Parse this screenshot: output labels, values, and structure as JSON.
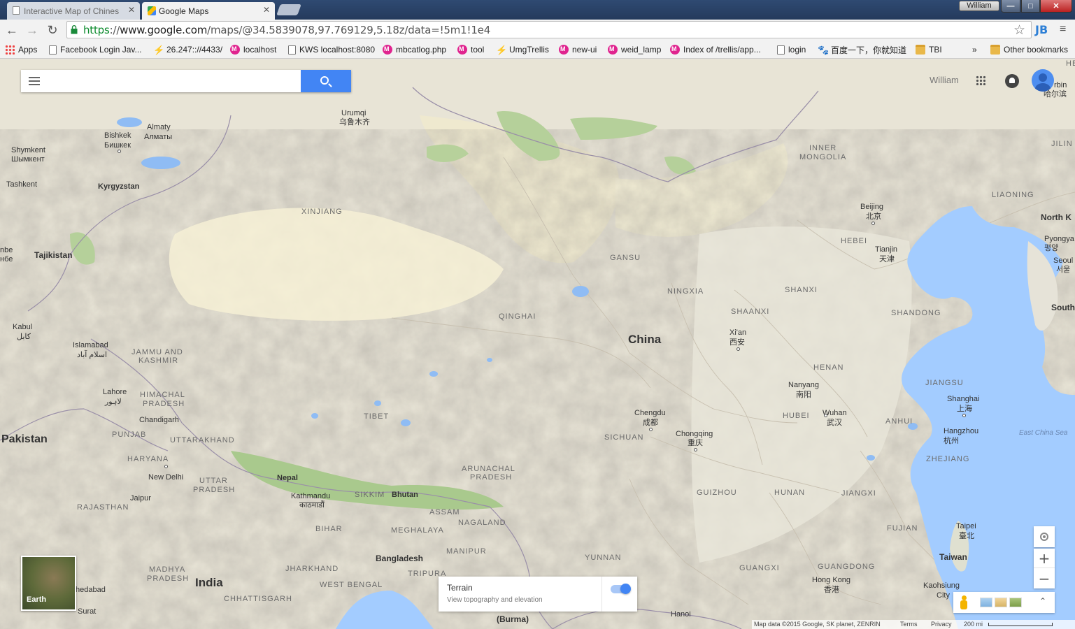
{
  "browser": {
    "tabs": [
      {
        "title": "Interactive Map of Chinese",
        "active": false
      },
      {
        "title": "Google Maps",
        "active": true
      }
    ],
    "profile_name": "William",
    "window_buttons": {
      "minimize": "—",
      "maximize": "□",
      "close": "✕"
    },
    "nav": {
      "back": "←",
      "forward": "→",
      "reload": "↻"
    },
    "url": {
      "scheme": "https",
      "sep": "://",
      "host": "www.google.com",
      "path": "/maps/@34.5839078,97.769129,5.18z/data=!5m1!1e4"
    },
    "star": "☆",
    "extension_label": "JB",
    "menu_glyph": "≡"
  },
  "bookmarks": {
    "items": [
      {
        "label": "Apps",
        "icon": "apps-grid-icon"
      },
      {
        "label": "Facebook Login Jav...",
        "icon": "page-icon"
      },
      {
        "label": "26.247:://4433/",
        "icon": "bolt-icon"
      },
      {
        "label": "localhost",
        "icon": "pink-m-icon"
      },
      {
        "label": "KWS localhost:8080",
        "icon": "page-icon"
      },
      {
        "label": "mbcatlog.php",
        "icon": "pink-m-icon"
      },
      {
        "label": "tool",
        "icon": "pink-m-icon"
      },
      {
        "label": "UmgTrellis",
        "icon": "bolt-icon"
      },
      {
        "label": "new-ui",
        "icon": "pink-m-icon"
      },
      {
        "label": "weid_lamp",
        "icon": "pink-m-icon"
      },
      {
        "label": "Index of /trellis/app...",
        "icon": "pink-m-icon"
      },
      {
        "label": "login",
        "icon": "page-icon"
      },
      {
        "label": "百度一下，你就知道",
        "icon": "paw-icon"
      },
      {
        "label": "TBI",
        "icon": "folder-icon"
      }
    ],
    "overflow": "»",
    "other": "Other bookmarks"
  },
  "maps": {
    "search": {
      "placeholder": "",
      "value": ""
    },
    "account_name": "William",
    "earth_label": "Earth",
    "terrain": {
      "title": "Terrain",
      "subtitle": "View topography and elevation",
      "enabled": true
    },
    "zoom_in": "+",
    "zoom_out": "−",
    "expand": "⌃",
    "footer": {
      "attribution": "Map data ©2015 Google, SK planet, ZENRIN",
      "terms": "Terms",
      "privacy": "Privacy",
      "scale": "200 mi"
    }
  },
  "places": {
    "urumqi": "Urumqi",
    "urumqi_zh": "乌鲁木齐",
    "almaty": "Almaty",
    "almaty_ru": "Алматы",
    "bishkek": "Bishkek",
    "bishkek_ru": "Бишкек",
    "shymkent": "Shymkent",
    "shymkent_ru": "Шымкент",
    "tashkent": "Tashkent",
    "kyrgyzstan": "Kyrgyzstan",
    "xinjiang": "XINJIANG",
    "tajikistan": "Tajikistan",
    "dushanbe_frag": "nbe",
    "dushanbe_frag2": "нбе",
    "kabul": "Kabul",
    "kabul_native": "کابل",
    "islamabad": "Islamabad",
    "islamabad_native": "اسلام آباد",
    "jammu": "JAMMU AND",
    "kashmir": "KASHMIR",
    "lahore": "Lahore",
    "lahore_native": "لاہور",
    "himachal": "HIMACHAL",
    "himachal2": "PRADESH",
    "chandigarh": "Chandigarh",
    "punjab": "PUNJAB",
    "uttarakhand": "UTTARAKHAND",
    "pakistan": "Pakistan",
    "haryana": "HARYANA",
    "new_delhi": "New Delhi",
    "uttar": "UTTAR",
    "uttar2": "PRADESH",
    "jaipur": "Jaipur",
    "rajasthan": "RAJASTHAN",
    "madhya": "MADHYA",
    "madhya2": "PRADESH",
    "india": "India",
    "ahmedabad": "hedabad",
    "surat": "Surat",
    "jharkhand": "JHARKHAND",
    "west_bengal": "WEST BENGAL",
    "chhattisgarh": "CHHATTISGARH",
    "bihar": "BIHAR",
    "nepal": "Nepal",
    "kathmandu": "Kathmandu",
    "kathmandu_native": "काठमाडौं",
    "sikkim": "SIKKIM",
    "bhutan": "Bhutan",
    "assam": "ASSAM",
    "arunachal": "ARUNACHAL",
    "arunachal2": "PRADESH",
    "nagaland": "NAGALAND",
    "meghalaya": "MEGHALAYA",
    "manipur": "MANIPUR",
    "bangladesh": "Bangladesh",
    "tripura": "TRIPURA",
    "burma": "(Burma)",
    "tibet": "TIBET",
    "qinghai": "QINGHAI",
    "gansu": "GANSU",
    "ningxia": "NINGXIA",
    "china": "China",
    "sichuan": "SICHUAN",
    "chengdu": "Chengdu",
    "chengdu_zh": "成都",
    "chongqing": "Chongqing",
    "chongqing_zh": "重庆",
    "yunnan": "YUNNAN",
    "guizhou": "GUIZHOU",
    "guangxi": "GUANGXI",
    "hanoi": "Hanoi",
    "shaanxi": "SHAANXI",
    "xian": "Xi'an",
    "xian_zh": "西安",
    "shanxi": "SHANXI",
    "inner_mongolia": "INNER",
    "inner_mongolia2": "MONGOLIA",
    "beijing": "Beijing",
    "beijing_zh": "北京",
    "hebei": "HEBEI",
    "tianjin": "Tianjin",
    "tianjin_zh": "天津",
    "shandong": "SHANDONG",
    "henan": "HENAN",
    "nanyang": "Nanyang",
    "nanyang_zh": "南阳",
    "jiangsu": "JIANGSU",
    "hubei": "HUBEI",
    "wuhan": "Wuhan",
    "wuhan_zh": "武汉",
    "anhui": "ANHUI",
    "shanghai": "Shanghai",
    "shanghai_zh": "上海",
    "hangzhou": "Hangzhou",
    "hangzhou_zh": "杭州",
    "zhejiang": "ZHEJIANG",
    "hunan": "HUNAN",
    "jiangxi": "JIANGXI",
    "fujian": "FUJIAN",
    "guangdong": "GUANGDONG",
    "hong_kong": "Hong Kong",
    "hong_kong_zh": "香港",
    "taipei": "Taipei",
    "taipei_zh": "臺北",
    "taiwan": "Taiwan",
    "kaohsiung": "Kaohsiung",
    "kaohsiung2": "City",
    "east_china_sea": "East China Sea",
    "liaoning": "LIAONING",
    "jilin": "JILIN",
    "north_korea": "North K",
    "pyongyang": "Pyongya",
    "pyongyang_ko": "평양",
    "seoul": "Seoul",
    "seoul_ko": "서울",
    "south": "South",
    "harbin": "rbin",
    "harbin_zh": "哈尔滨",
    "he_frag": "HE"
  },
  "colors": {
    "land": "#e7e2d2",
    "water": "#a3ccff",
    "desert": "#f2ecd0",
    "green": "#b5d29a",
    "search_blue": "#4285f4"
  }
}
